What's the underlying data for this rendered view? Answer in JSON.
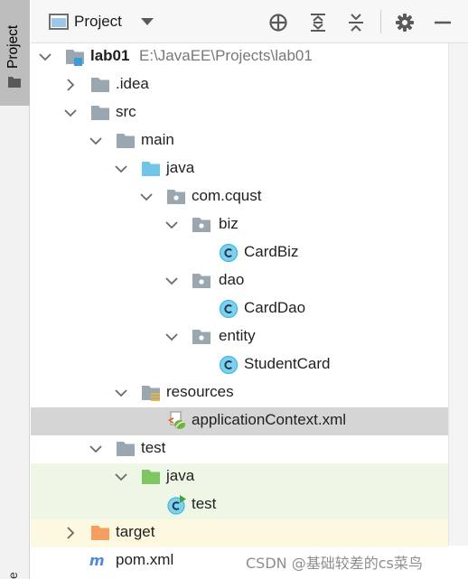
{
  "side_panel": {
    "tab_label": "Project",
    "bottom_label": "e"
  },
  "header": {
    "view_label": "Project",
    "buttons": [
      {
        "icon": "locate-icon"
      },
      {
        "icon": "expand-all-icon"
      },
      {
        "icon": "collapse-all-icon"
      },
      {
        "icon": "gear-icon"
      },
      {
        "icon": "hide-icon"
      }
    ]
  },
  "tree": {
    "rows": [
      {
        "label": "lab01",
        "path": "E:\\JavaEE\\Projects\\lab01",
        "icon": "module-folder-icon",
        "expanded": true
      },
      {
        "label": ".idea",
        "icon": "folder-icon",
        "expanded": false
      },
      {
        "label": "src",
        "icon": "folder-icon",
        "expanded": true
      },
      {
        "label": "main",
        "icon": "folder-icon",
        "expanded": true
      },
      {
        "label": "java",
        "icon": "source-folder-icon",
        "expanded": true
      },
      {
        "label": "com.cqust",
        "icon": "package-icon",
        "expanded": true
      },
      {
        "label": "biz",
        "icon": "package-icon",
        "expanded": true
      },
      {
        "label": "CardBiz",
        "icon": "class-icon"
      },
      {
        "label": "dao",
        "icon": "package-icon",
        "expanded": true
      },
      {
        "label": "CardDao",
        "icon": "class-icon"
      },
      {
        "label": "entity",
        "icon": "package-icon",
        "expanded": true
      },
      {
        "label": "StudentCard",
        "icon": "class-icon"
      },
      {
        "label": "resources",
        "icon": "resources-folder-icon",
        "expanded": true
      },
      {
        "label": "applicationContext.xml",
        "icon": "spring-xml-icon",
        "selected": true
      },
      {
        "label": "test",
        "icon": "folder-icon",
        "expanded": true
      },
      {
        "label": "java",
        "icon": "test-source-folder-icon",
        "expanded": true
      },
      {
        "label": "test",
        "icon": "test-class-icon"
      },
      {
        "label": "target",
        "icon": "excluded-folder-icon",
        "expanded": false
      },
      {
        "label": "pom.xml",
        "icon": "maven-icon"
      }
    ]
  },
  "watermark": "CSDN @基础较差的cs菜鸟",
  "colors": {
    "selection": "#d5d5d5",
    "test_background": "#eef7e5",
    "excluded_background": "#fdf8e0",
    "folder": "#9aa7b0",
    "source_folder": "#6fc4e8",
    "test_folder": "#7ec563",
    "excluded_folder": "#f59e63",
    "class_badge": "#40b6e0",
    "maven": "#4f8ad8"
  }
}
